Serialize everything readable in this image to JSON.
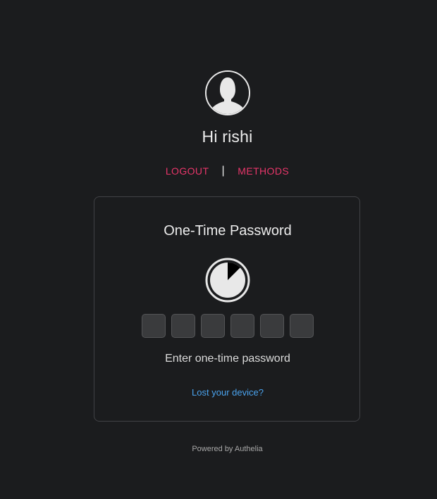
{
  "user": {
    "greeting": "Hi rishi"
  },
  "nav": {
    "logout_label": "LOGOUT",
    "separator": "|",
    "methods_label": "METHODS"
  },
  "card": {
    "title": "One-Time Password",
    "otp_digit_count": 6,
    "timer_remaining_fraction": 0.875,
    "prompt": "Enter one-time password",
    "lost_device_label": "Lost your device?"
  },
  "footer": {
    "powered_by": "Powered by Authelia"
  },
  "colors": {
    "background": "#1b1c1e",
    "accent_red": "#e8366a",
    "link_blue": "#4aa3ee",
    "text": "#ededed",
    "field": "#3a3b3d"
  },
  "icons": {
    "avatar": "user-avatar-icon",
    "timer": "otp-timer-icon"
  }
}
